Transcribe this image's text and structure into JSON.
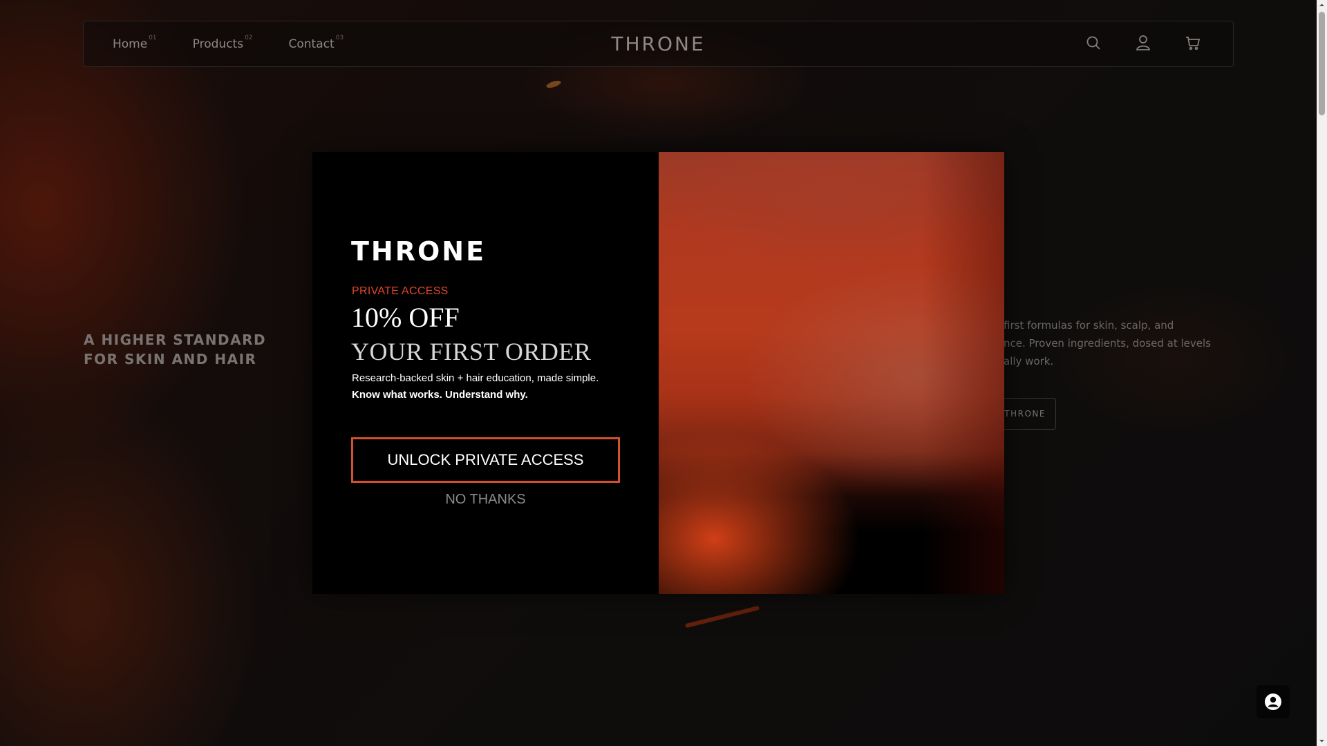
{
  "header": {
    "brand": "THRONE",
    "nav": [
      {
        "label": "Home",
        "index": "01"
      },
      {
        "label": "Products",
        "index": "02"
      },
      {
        "label": "Contact",
        "index": "03"
      }
    ],
    "icons": [
      "search-icon",
      "account-icon",
      "cart-icon"
    ]
  },
  "hero": {
    "headline_line1": "A HIGHER STANDARD",
    "headline_line2": "FOR SKIN AND HAIR",
    "body_line1": "first formulas for skin, scalp, and",
    "body_line2": "nce. Proven ingredients, dosed at levels",
    "body_line3": "ally work.",
    "cta_label": "THRONE"
  },
  "modal": {
    "logo": "THRONE",
    "kicker": "PRIVATE ACCESS",
    "headline": "10% OFF",
    "subheadline": "YOUR FIRST ORDER",
    "body": "Research-backed skin + hair education, made simple.",
    "body_bold": "Know what works. Understand why.",
    "primary_button": "UNLOCK PRIVATE ACCESS",
    "secondary_button": "NO THANKS"
  },
  "chat": {
    "icon": "user-circle-icon"
  },
  "colors": {
    "accent": "#e2472a",
    "button_border": "#d4512e",
    "modal_bg": "#000000",
    "page_bg": "#0e0b0a"
  }
}
